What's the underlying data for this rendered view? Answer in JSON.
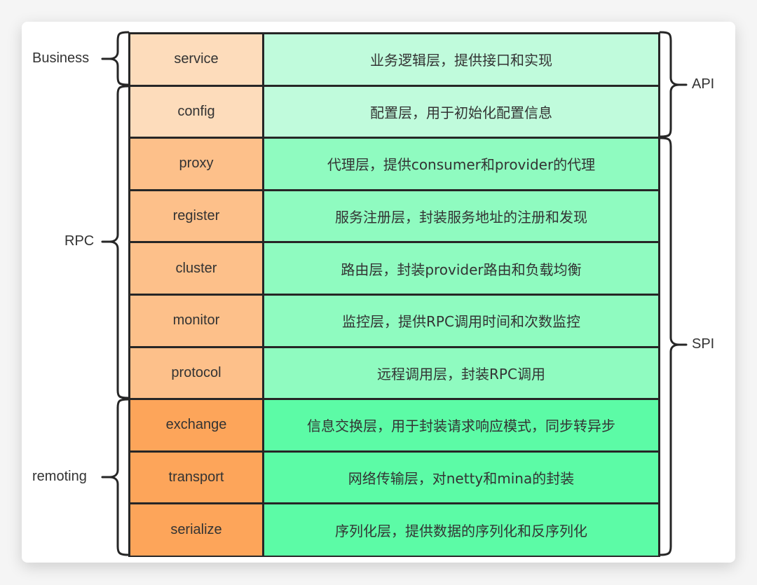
{
  "layers": [
    {
      "name": "service",
      "desc": "业务逻辑层，提供接口和实现",
      "name_color": "#fddcbb",
      "desc_color": "#c0fbdc"
    },
    {
      "name": "config",
      "desc": "配置层，用于初始化配置信息",
      "name_color": "#fddcbb",
      "desc_color": "#c0fbdc"
    },
    {
      "name": "proxy",
      "desc": "代理层，提供consumer和provider的代理",
      "name_color": "#fdc08a",
      "desc_color": "#8ffbc0"
    },
    {
      "name": "register",
      "desc": "服务注册层，封装服务地址的注册和发现",
      "name_color": "#fdc08a",
      "desc_color": "#8ffbc0"
    },
    {
      "name": "cluster",
      "desc": "路由层，封装provider路由和负载均衡",
      "name_color": "#fdc08a",
      "desc_color": "#8ffbc0"
    },
    {
      "name": "monitor",
      "desc": "监控层，提供RPC调用时间和次数监控",
      "name_color": "#fdc08a",
      "desc_color": "#8ffbc0"
    },
    {
      "name": "protocol",
      "desc": "远程调用层，封装RPC调用",
      "name_color": "#fdc08a",
      "desc_color": "#8ffbc0"
    },
    {
      "name": "exchange",
      "desc": "信息交换层，用于封装请求响应模式，同步转异步",
      "name_color": "#fda55a",
      "desc_color": "#5cfba6"
    },
    {
      "name": "transport",
      "desc": "网络传输层，对netty和mina的封装",
      "name_color": "#fda55a",
      "desc_color": "#5cfba6"
    },
    {
      "name": "serialize",
      "desc": "序列化层，提供数据的序列化和反序列化",
      "name_color": "#fda55a",
      "desc_color": "#5cfba6"
    }
  ],
  "left_groups": {
    "business": "Business",
    "rpc": "RPC",
    "remoting": "remoting"
  },
  "right_groups": {
    "api": "API",
    "spi": "SPI"
  }
}
